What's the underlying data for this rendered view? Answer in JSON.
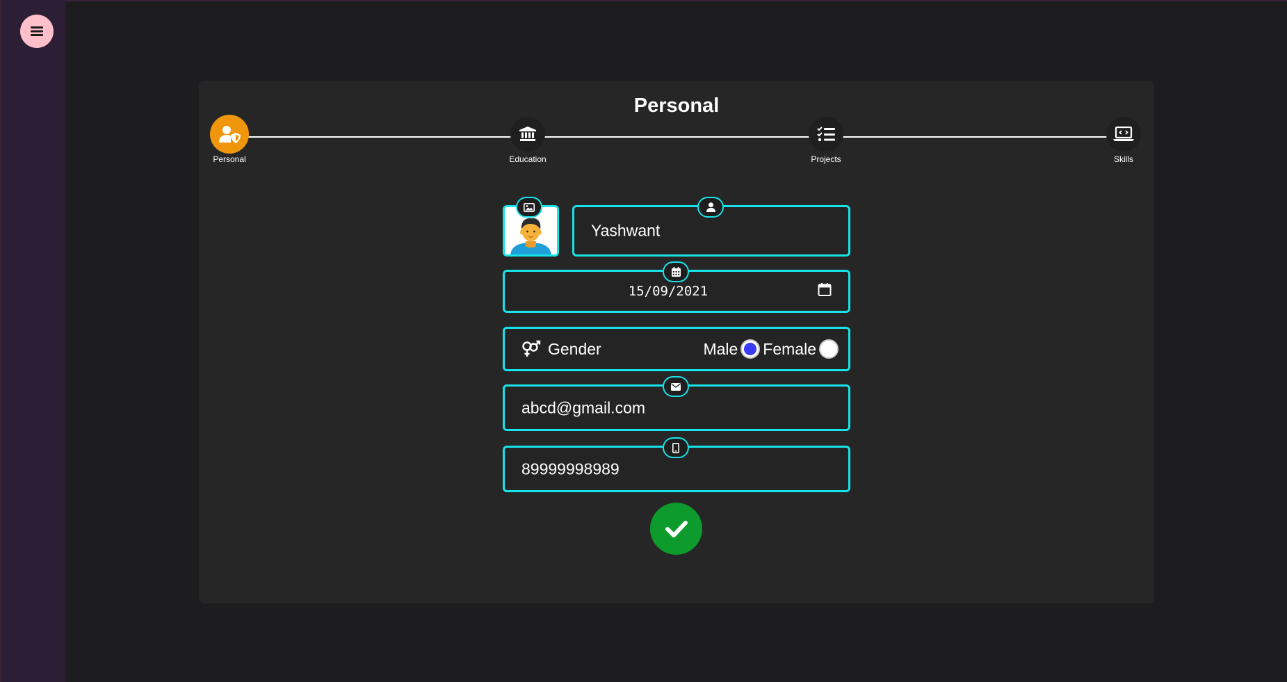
{
  "app": {
    "colors": {
      "background": "#1d1d20",
      "sidebar": "#2c1f35",
      "menu_button": "#ffc0cb",
      "card": "#262626",
      "accent_border": "#17e3e8",
      "active_step": "#f0960d",
      "submit": "#0c9b2c",
      "radio_selected": "#3b3bf5"
    }
  },
  "sidebar": {
    "menu_icon": "hamburger-icon"
  },
  "card": {
    "title": "Personal"
  },
  "steps": [
    {
      "label": "Personal",
      "icon": "user-shield-icon",
      "active": true
    },
    {
      "label": "Education",
      "icon": "university-icon",
      "active": false
    },
    {
      "label": "Projects",
      "icon": "tasks-list-icon",
      "active": false
    },
    {
      "label": "Skills",
      "icon": "laptop-code-icon",
      "active": false
    }
  ],
  "form": {
    "photo": {
      "icon": "image-icon"
    },
    "name": {
      "icon": "user-icon",
      "value": "Yashwant"
    },
    "dob": {
      "icon": "calendar-icon",
      "value": "15/09/2021",
      "picker_icon": "calendar-outline-icon"
    },
    "gender": {
      "icon": "gender-icon",
      "label": "Gender",
      "options": [
        {
          "label": "Male",
          "selected": true
        },
        {
          "label": "Female",
          "selected": false
        }
      ]
    },
    "email": {
      "icon": "envelope-icon",
      "value": "abcd@gmail.com"
    },
    "phone": {
      "icon": "mobile-icon",
      "value": "89999998989"
    },
    "submit": {
      "icon": "check-icon"
    }
  }
}
